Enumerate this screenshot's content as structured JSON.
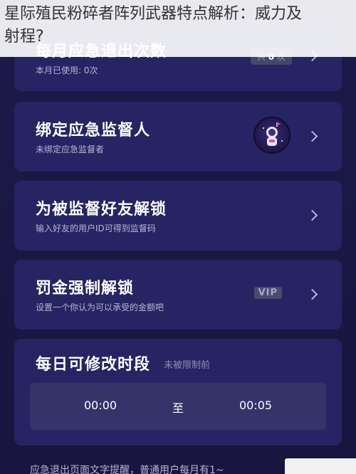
{
  "overlay": {
    "line1": "星际殖民粉碎者阵列武器特点解析：威力及",
    "line2": "射程?"
  },
  "cards": {
    "monthly_exit": {
      "title": "每月应急退出次数",
      "subtitle": "本月已使用: 0次",
      "badge_prefix": "共",
      "badge_count": "0",
      "badge_suffix": "次"
    },
    "supervisor": {
      "title": "绑定应急监督人",
      "subtitle": "未绑定应急监督者"
    },
    "unlock_friend": {
      "title": "为被监督好友解锁",
      "subtitle": "输入好友的用户ID可得到监督码"
    },
    "fine_unlock": {
      "title": "罚金强制解锁",
      "subtitle": "设置一个你认为可以承受的金额吧",
      "vip_label": "VIP"
    },
    "daily_period": {
      "title": "每日可修改时段",
      "status": "未被限制前",
      "start_time": "00:00",
      "separator": "至",
      "end_time": "00:05"
    }
  },
  "bottom_note": "应急退出页面文字提醒，普通用户每月有1~",
  "colors": {
    "background": "#1b1846",
    "card": "#262463",
    "time_box": "#34336a"
  }
}
